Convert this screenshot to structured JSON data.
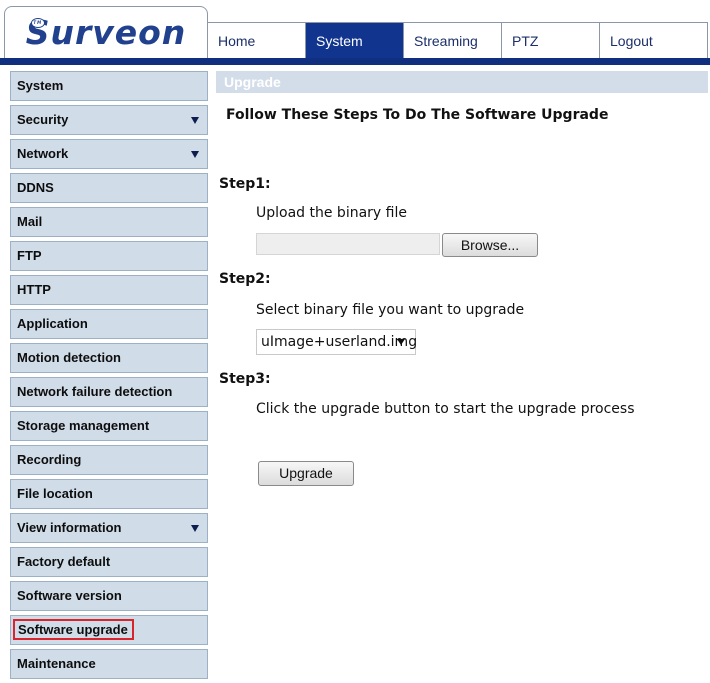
{
  "brand": {
    "logo_text": "Surveon",
    "logo_badge": "TM"
  },
  "nav": {
    "tabs": [
      {
        "label": "Home",
        "active": false
      },
      {
        "label": "System",
        "active": true
      },
      {
        "label": "Streaming",
        "active": false
      },
      {
        "label": "PTZ",
        "active": false
      },
      {
        "label": "Logout",
        "active": false
      }
    ]
  },
  "sidebar": {
    "items": [
      {
        "label": "System",
        "has_submenu": false
      },
      {
        "label": "Security",
        "has_submenu": true
      },
      {
        "label": "Network",
        "has_submenu": true
      },
      {
        "label": "DDNS",
        "has_submenu": false
      },
      {
        "label": "Mail",
        "has_submenu": false
      },
      {
        "label": "FTP",
        "has_submenu": false
      },
      {
        "label": "HTTP",
        "has_submenu": false
      },
      {
        "label": "Application",
        "has_submenu": false
      },
      {
        "label": "Motion detection",
        "has_submenu": false
      },
      {
        "label": "Network failure detection",
        "has_submenu": false
      },
      {
        "label": "Storage management",
        "has_submenu": false
      },
      {
        "label": "Recording",
        "has_submenu": false
      },
      {
        "label": "File location",
        "has_submenu": false
      },
      {
        "label": "View information",
        "has_submenu": true
      },
      {
        "label": "Factory default",
        "has_submenu": false
      },
      {
        "label": "Software version",
        "has_submenu": false
      },
      {
        "label": "Software upgrade",
        "has_submenu": false,
        "highlighted": true
      },
      {
        "label": "Maintenance",
        "has_submenu": false
      }
    ]
  },
  "main": {
    "section_title": "Upgrade",
    "intro": "Follow These Steps To Do The Software Upgrade",
    "step1": {
      "label": "Step1:",
      "text": "Upload the binary file",
      "file_value": "",
      "browse_label": "Browse..."
    },
    "step2": {
      "label": "Step2:",
      "text": "Select binary file you want to upgrade",
      "selected_file": "uImage+userland.img"
    },
    "step3": {
      "label": "Step3:",
      "text": "Click the upgrade button to start the upgrade process",
      "upgrade_label": "Upgrade"
    }
  },
  "colors": {
    "brand_blue": "#21418f",
    "nav_active": "#11348e",
    "header_rule": "#10307f",
    "sidebar_bg": "#d0dce8",
    "highlight_red": "#d8242d",
    "section_bar": "#d3dde9"
  },
  "icons": {
    "submenu": "caret-down-icon",
    "dropdown": "dropdown-arrow-icon"
  }
}
